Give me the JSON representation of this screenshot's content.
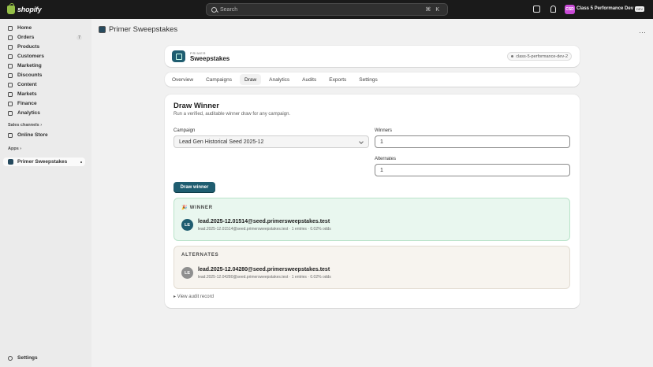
{
  "topbar": {
    "brand": "shopify",
    "search_placeholder": "Search",
    "search_shortcut": "⌘ K",
    "store_initials": "CSD",
    "store_name": "Class 5 Performance Dev",
    "store_tag": "DEV"
  },
  "sidebar": {
    "items": [
      {
        "label": "Home",
        "icon": "home-icon"
      },
      {
        "label": "Orders",
        "icon": "orders-icon",
        "badge": "7"
      },
      {
        "label": "Products",
        "icon": "tag-icon"
      },
      {
        "label": "Customers",
        "icon": "person-icon"
      },
      {
        "label": "Marketing",
        "icon": "target-icon"
      },
      {
        "label": "Discounts",
        "icon": "discount-icon"
      },
      {
        "label": "Content",
        "icon": "content-icon"
      },
      {
        "label": "Markets",
        "icon": "globe-icon"
      },
      {
        "label": "Finance",
        "icon": "bank-icon"
      },
      {
        "label": "Analytics",
        "icon": "chart-icon"
      }
    ],
    "sales_channels_label": "Sales channels",
    "online_store": "Online Store",
    "apps_label": "Apps",
    "app_item": "Primer Sweepstakes",
    "settings": "Settings"
  },
  "page": {
    "title": "Primer Sweepstakes"
  },
  "app_header": {
    "kicker": "PRIMER",
    "name": "Sweepstakes",
    "env": "class-5-performance-dev-2"
  },
  "tabs": [
    "Overview",
    "Campaigns",
    "Draw",
    "Analytics",
    "Audits",
    "Exports",
    "Settings"
  ],
  "active_tab": "Draw",
  "draw": {
    "title": "Draw Winner",
    "subtitle": "Run a verified, auditable winner draw for any campaign.",
    "campaign_label": "Campaign",
    "campaign_value": "Lead Gen Historical Seed 2025-12",
    "winners_label": "Winners",
    "winners_value": "1",
    "alternates_label": "Alternates",
    "alternates_value": "1",
    "button": "Draw winner",
    "winner": {
      "section": "🎉 WINNER",
      "initials": "LE",
      "email": "lead.2025-12.01514@seed.primersweepstakes.test",
      "meta": "lead.2025-12.01514@seed.primersweepstakes.test · 1 entries · 0.02% odds"
    },
    "alternate": {
      "section": "ALTERNATES",
      "initials": "LE",
      "email": "lead.2025-12.04280@seed.primersweepstakes.test",
      "meta": "lead.2025-12.04280@seed.primersweepstakes.test · 1 entries · 0.02% odds"
    },
    "audit_link": "▸ View audit record"
  }
}
